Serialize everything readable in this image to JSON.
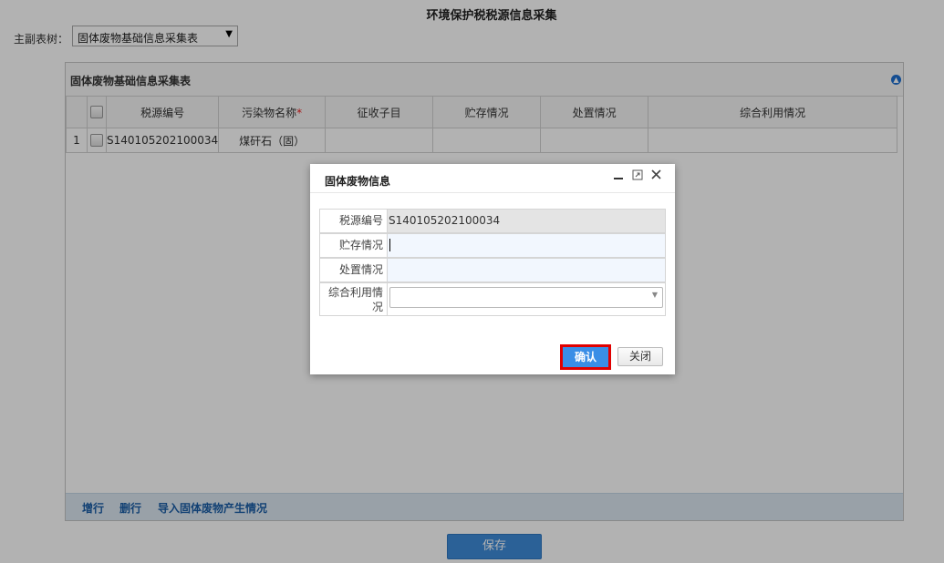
{
  "page": {
    "title": "环境保护税税源信息采集"
  },
  "tree": {
    "label": "主副表树：",
    "selected": "固体废物基础信息采集表"
  },
  "panel": {
    "title": "固体废物基础信息采集表",
    "columns": [
      "税源编号",
      "污染物名称",
      "征收子目",
      "贮存情况",
      "处置情况",
      "综合利用情况"
    ],
    "required_marker": "*",
    "rows": [
      {
        "index": "1",
        "source_id": "S140105202100034",
        "pollutant": "煤矸石（固）",
        "sub_item": "",
        "storage": "",
        "disposal": "",
        "utilization": ""
      }
    ],
    "footer_links": [
      "增行",
      "删行",
      "导入固体废物产生情况"
    ]
  },
  "save_label": "保存",
  "dialog": {
    "title": "固体废物信息",
    "fields": {
      "source_id": {
        "label": "税源编号",
        "value": "S140105202100034"
      },
      "storage": {
        "label": "贮存情况",
        "value": ""
      },
      "disposal": {
        "label": "处置情况",
        "value": ""
      },
      "utilization": {
        "label_line1": "综合利用情",
        "label_line2": "况",
        "value": ""
      }
    },
    "confirm_label": "确认",
    "close_label": "关闭"
  },
  "icons": {
    "minimize": "minimize-icon",
    "maximize": "maximize-icon",
    "close": "close-icon",
    "collapse": "collapse-icon",
    "dropdown": "chevron-down-icon"
  },
  "colors": {
    "highlight": "#e00000",
    "primary": "#3a8ee6",
    "link": "#1b5da6"
  }
}
